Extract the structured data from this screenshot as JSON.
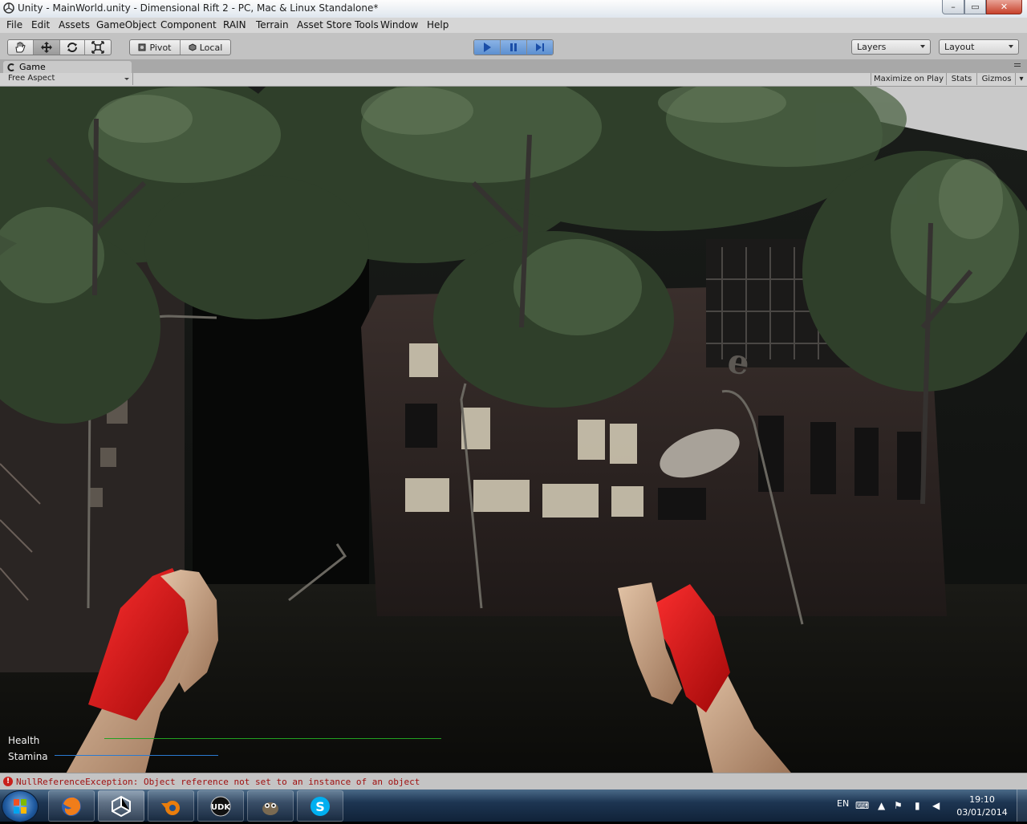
{
  "window": {
    "title": "Unity - MainWorld.unity - Dimensional Rift 2 - PC, Mac & Linux Standalone*",
    "controls": {
      "minimize": "–",
      "maximize": "▭",
      "close": "✕"
    }
  },
  "menu": [
    "File",
    "Edit",
    "Assets",
    "GameObject",
    "Component",
    "RAIN",
    "Terrain",
    "Asset Store Tools",
    "Window",
    "Help"
  ],
  "toolbar": {
    "transform_tools": [
      "hand-icon",
      "move-icon",
      "rotate-icon",
      "scale-icon"
    ],
    "pivot_label": "Pivot",
    "local_label": "Local",
    "play_controls": [
      "play-icon",
      "pause-icon",
      "step-icon"
    ],
    "layers_label": "Layers",
    "layout_label": "Layout"
  },
  "game_view": {
    "tab_label": "Game",
    "aspect": "Free Aspect",
    "maximize_on_play": "Maximize on Play",
    "stats": "Stats",
    "gizmos": "Gizmos"
  },
  "hud": {
    "health_label": "Health",
    "stamina_label": "Stamina",
    "health_level": 1.0,
    "stamina_level": 1.0,
    "health_color": "#22a022",
    "stamina_color": "#2a7ad0"
  },
  "status": {
    "error": "NullReferenceException: Object reference not set to an instance of an object",
    "error_color": "#a01010"
  },
  "taskbar": {
    "apps": [
      "firefox-icon",
      "unity-icon",
      "blender-icon",
      "udk-icon",
      "gimp-icon",
      "skype-icon"
    ],
    "app_labels": {
      "udk": "UDK",
      "skype": "S"
    },
    "language": "EN",
    "time": "19:10",
    "date": "03/01/2014"
  }
}
